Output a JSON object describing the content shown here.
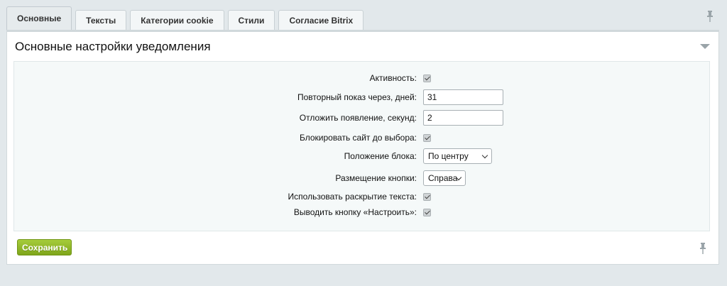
{
  "tabs": [
    {
      "label": "Основные",
      "active": true
    },
    {
      "label": "Тексты",
      "active": false
    },
    {
      "label": "Категории cookie",
      "active": false
    },
    {
      "label": "Стили",
      "active": false
    },
    {
      "label": "Согласие Bitrix",
      "active": false
    }
  ],
  "panel": {
    "title": "Основные настройки уведомления"
  },
  "form": {
    "active_label": "Активность:",
    "active_checked": true,
    "repeat_label": "Повторный показ через, дней:",
    "repeat_value": "31",
    "delay_label": "Отложить появление, секунд:",
    "delay_value": "2",
    "block_label": "Блокировать сайт до выбора:",
    "block_checked": true,
    "position_label": "Положение блока:",
    "position_value": "По центру",
    "button_place_label": "Размещение кнопки:",
    "button_place_value": "Справа",
    "expand_label": "Использовать раскрытие текста:",
    "expand_checked": true,
    "configure_label": "Выводить кнопку «Настроить»:",
    "configure_checked": true
  },
  "actions": {
    "save_label": "Сохранить"
  },
  "colors": {
    "save_button": "#8db526",
    "background": "#e2e8eb"
  },
  "icons": {
    "pin": "pin-icon",
    "collapse": "triangle-down-icon"
  }
}
